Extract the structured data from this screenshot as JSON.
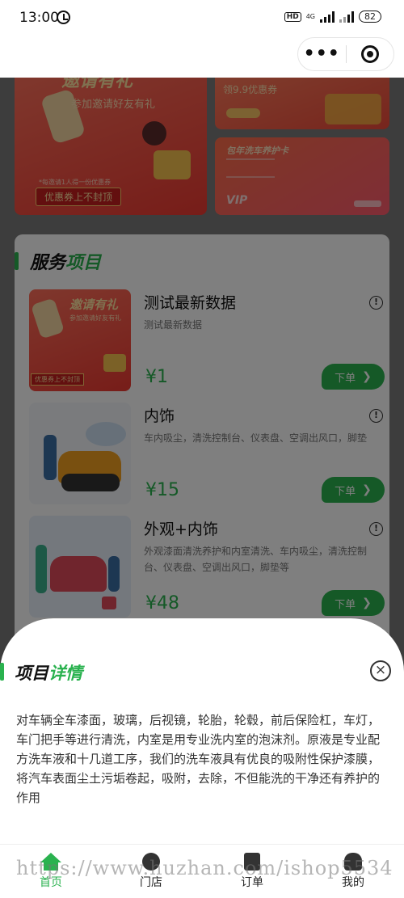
{
  "status_bar": {
    "time": "13:00",
    "network_badge": "HD",
    "network_type": "4G",
    "battery": "82"
  },
  "banners": {
    "left_subtitle": "参加邀请好友有礼",
    "left_title": "邀请有礼",
    "left_note": "*每邀请1人得一份优惠券",
    "left_ribbon": "优惠券上不封顶",
    "top_right_title": "领9.9优惠券",
    "bottom_right_title": "包年洗车养护卡",
    "bottom_right_vip": "VIP"
  },
  "services": {
    "title_black": "服务",
    "title_green": "项目",
    "items": [
      {
        "name": "测试最新数据",
        "desc": "测试最新数据",
        "price": "¥1",
        "order_label": "下单",
        "thumb_title": "邀请有礼",
        "thumb_sub": "参加邀请好友有礼",
        "thumb_ribbon": "优惠券上不封顶"
      },
      {
        "name": "内饰",
        "desc": "车内吸尘，清洗控制台、仪表盘、空调出风口，脚垫",
        "price": "¥15",
        "order_label": "下单"
      },
      {
        "name": "外观+内饰",
        "desc": "外观漆面清洗养护和内室清洗、车内吸尘，清洗控制台、仪表盘、空调出风口，脚垫等",
        "price": "¥48",
        "order_label": "下单"
      }
    ]
  },
  "detail_sheet": {
    "title_black": "项目",
    "title_green": "详情",
    "close_symbol": "×",
    "body": "对车辆全车漆面，玻璃，后视镜，轮胎，轮毂，前后保险杠，车灯，车门把手等进行清洗，内室是用专业洗内室的泡沫剂。原液是专业配方洗车液和十几道工序，我们的洗车液具有优良的吸附性保护漆膜，将汽车表面尘土污垢卷起，吸附，去除，不但能洗的干净还有养护的作用"
  },
  "tabbar": {
    "items": [
      {
        "label": "首页",
        "icon": "home-icon",
        "active": true
      },
      {
        "label": "门店",
        "icon": "store-icon",
        "active": false
      },
      {
        "label": "订单",
        "icon": "order-icon",
        "active": false
      },
      {
        "label": "我的",
        "icon": "profile-icon",
        "active": false
      }
    ]
  },
  "watermark": "https://www.huzhan.com/ishop5534",
  "colors": {
    "accent_green": "#2ab24f",
    "banner_red": "#ee3a32",
    "overlay": "rgba(0,0,0,0.5)"
  }
}
